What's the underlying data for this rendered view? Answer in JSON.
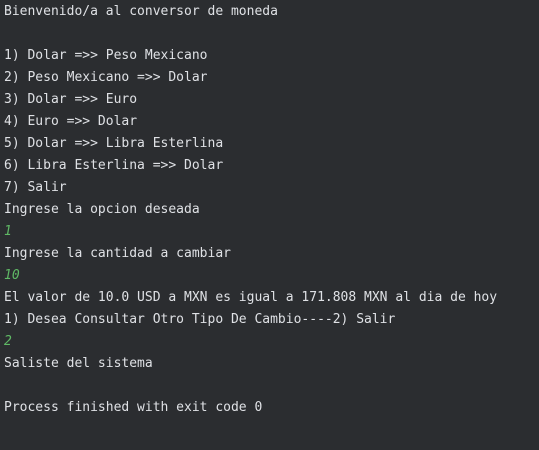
{
  "console": {
    "welcome": "Bienvenido/a al conversor de moneda",
    "options": [
      "1) Dolar =>> Peso Mexicano",
      "2) Peso Mexicano =>> Dolar",
      "3) Dolar =>> Euro",
      "4) Euro =>> Dolar",
      "5) Dolar =>> Libra Esterlina",
      "6) Libra Esterlina =>> Dolar",
      "7) Salir"
    ],
    "prompt_option": "Ingrese la opcion deseada",
    "input_option": "1",
    "prompt_amount": "Ingrese la cantidad a cambiar",
    "input_amount": "10",
    "result": "El valor de 10.0 USD a MXN es igual a 171.808 MXN al dia de hoy",
    "prompt_continue": "1) Desea Consultar Otro Tipo De Cambio----2) Salir",
    "input_continue": "2",
    "exit_message": "Saliste del sistema",
    "process_finished": "Process finished with exit code 0"
  },
  "colors": {
    "background": "#2b2d30",
    "text": "#dfe1e5",
    "user_input": "#5fb865"
  }
}
